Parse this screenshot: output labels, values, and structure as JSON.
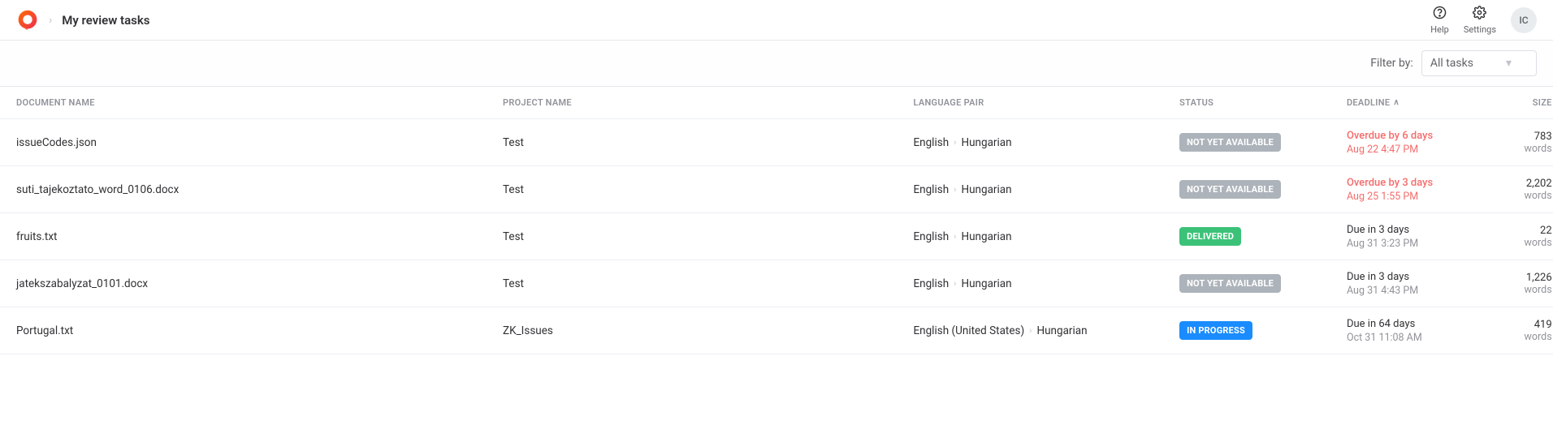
{
  "header": {
    "page_title": "My review tasks",
    "help_label": "Help",
    "settings_label": "Settings",
    "avatar_initials": "IC"
  },
  "filter": {
    "label": "Filter by:",
    "selected": "All tasks"
  },
  "columns": {
    "doc": "DOCUMENT NAME",
    "project": "PROJECT NAME",
    "lang": "LANGUAGE PAIR",
    "status": "STATUS",
    "deadline": "DEADLINE",
    "deadline_sort": "asc",
    "size": "SIZE"
  },
  "rows": [
    {
      "doc": "issueCodes.json",
      "project": "Test",
      "lang_from": "English",
      "lang_to": "Hungarian",
      "status_key": "notavail",
      "status_label": "NOT YET AVAILABLE",
      "dl_main": "Overdue by 6 days",
      "dl_sub": "Aug 22 4:47 PM",
      "overdue": true,
      "size_count": "783",
      "size_unit": "words"
    },
    {
      "doc": "suti_tajekoztato_word_0106.docx",
      "project": "Test",
      "lang_from": "English",
      "lang_to": "Hungarian",
      "status_key": "notavail",
      "status_label": "NOT YET AVAILABLE",
      "dl_main": "Overdue by 3 days",
      "dl_sub": "Aug 25 1:55 PM",
      "overdue": true,
      "size_count": "2,202",
      "size_unit": "words"
    },
    {
      "doc": "fruits.txt",
      "project": "Test",
      "lang_from": "English",
      "lang_to": "Hungarian",
      "status_key": "delivered",
      "status_label": "DELIVERED",
      "dl_main": "Due in 3 days",
      "dl_sub": "Aug 31 3:23 PM",
      "overdue": false,
      "size_count": "22",
      "size_unit": "words"
    },
    {
      "doc": "jatekszabalyzat_0101.docx",
      "project": "Test",
      "lang_from": "English",
      "lang_to": "Hungarian",
      "status_key": "notavail",
      "status_label": "NOT YET AVAILABLE",
      "dl_main": "Due in 3 days",
      "dl_sub": "Aug 31 4:43 PM",
      "overdue": false,
      "size_count": "1,226",
      "size_unit": "words"
    },
    {
      "doc": "Portugal.txt",
      "project": "ZK_Issues",
      "lang_from": "English (United States)",
      "lang_to": "Hungarian",
      "status_key": "inprogress",
      "status_label": "IN PROGRESS",
      "dl_main": "Due in 64 days",
      "dl_sub": "Oct 31 11:08 AM",
      "overdue": false,
      "size_count": "419",
      "size_unit": "words"
    }
  ]
}
